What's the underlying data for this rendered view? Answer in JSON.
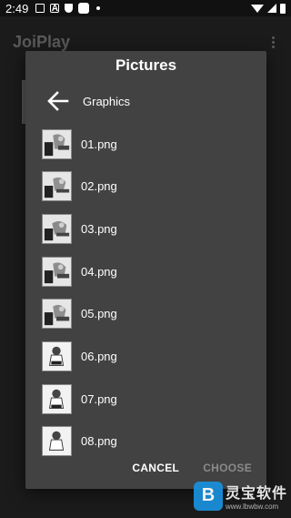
{
  "status": {
    "time": "2:49"
  },
  "app": {
    "title": "JoiPlay"
  },
  "dialog": {
    "title": "Pictures",
    "folder": "Graphics",
    "files": [
      {
        "name": "01.png"
      },
      {
        "name": "02.png"
      },
      {
        "name": "03.png"
      },
      {
        "name": "04.png"
      },
      {
        "name": "05.png"
      },
      {
        "name": "06.png"
      },
      {
        "name": "07.png"
      },
      {
        "name": "08.png"
      }
    ],
    "cancel_label": "CANCEL",
    "choose_label": "CHOOSE"
  },
  "watermark": {
    "name": "灵宝软件",
    "url": "www.lbwbw.com",
    "logo_letter": "B"
  },
  "colors": {
    "background": "#1b1b1b",
    "dialog": "#424242",
    "disabled_text": "#8a8a8a",
    "watermark_blue": "#1a8ed8"
  }
}
